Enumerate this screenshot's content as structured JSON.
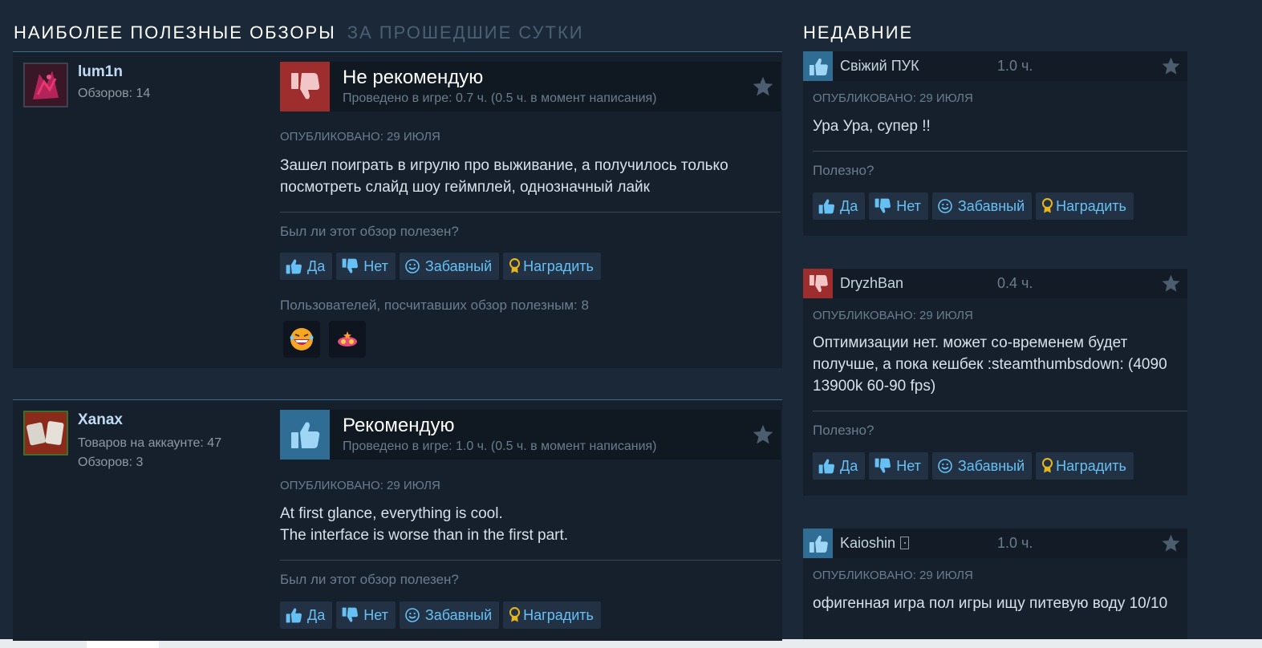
{
  "header": {
    "title": "НАИБОЛЕЕ ПОЛЕЗНЫЕ ОБЗОРЫ",
    "period": "ЗА ПРОШЕДШИЕ СУТКИ",
    "recent_title": "НЕДАВНИЕ"
  },
  "reviews": [
    {
      "author": "lum1n",
      "stats": [
        "Обзоров: 14"
      ],
      "verdict": "Не рекомендую",
      "recommended": false,
      "hours": "Проведено в игре: 0.7 ч. (0.5 ч. в момент написания)",
      "posted": "ОПУБЛИКОВАНО: 29 ИЮЛЯ",
      "text": "Зашел поиграть в игрулю про выживание, а получилось только посмотреть слайд шоу геймплей, однозначный лайк",
      "helpful_question": "Был ли этот обзор полезен?",
      "helpful_count": "Пользователей, посчитавших обзор полезным: 8"
    },
    {
      "author": "Xanax",
      "stats": [
        "Товаров на аккаунте: 47",
        "Обзоров: 3"
      ],
      "verdict": "Рекомендую",
      "recommended": true,
      "hours": "Проведено в игре: 1.0 ч. (0.5 ч. в момент написания)",
      "posted": "ОПУБЛИКОВАНО: 29 ИЮЛЯ",
      "text_lines": [
        "At first glance, everything is cool.",
        "The interface is worse than in the first part."
      ],
      "helpful_question": "Был ли этот обзор полезен?"
    }
  ],
  "buttons": {
    "yes": "Да",
    "no": "Нет",
    "funny": "Забавный",
    "award": "Наградить"
  },
  "recent": [
    {
      "author": "Свіжий ПУК",
      "hours": "1.0 ч.",
      "recommended": true,
      "posted": "ОПУБЛИКОВАНО: 29 ИЮЛЯ",
      "text": "Ура Ура, супер !!",
      "helpful_question": "Полезно?"
    },
    {
      "author": "DryzhBan",
      "hours": "0.4 ч.",
      "recommended": false,
      "posted": "ОПУБЛИКОВАНО: 29 ИЮЛЯ",
      "text": "Оптимизации нет. может со-временем будет получше, а пока кешбек :steamthumbsdown: (4090 13900k 60-90 fps)",
      "helpful_question": "Полезно?"
    },
    {
      "author": "Kaioshin",
      "hours": "1.0 ч.",
      "recommended": true,
      "posted": "ОПУБЛИКОВАНО: 29 ИЮЛЯ",
      "text": "офигенная игра пол игры ищу питевую воду 10/10"
    }
  ],
  "colors": {
    "background": "#1b2838",
    "panel": "#16202d",
    "accent_blue": "#66c0f4",
    "thumb_up_bg": "#2f6d94",
    "thumb_down_bg": "#9e2d2d",
    "award_gold": "#e8b51c"
  },
  "icons": {
    "thumbs_up": "thumbs-up-icon",
    "thumbs_down": "thumbs-down-icon",
    "smile": "smile-icon",
    "award": "award-ribbon-icon",
    "favorite": "star-icon"
  }
}
